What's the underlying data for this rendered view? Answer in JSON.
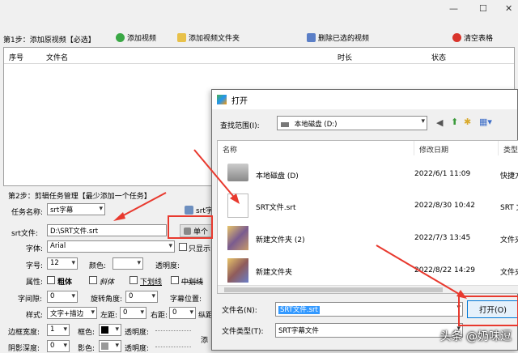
{
  "window": {
    "minimize": "—",
    "maximize": "☐",
    "close": "✕"
  },
  "step1": {
    "label": "第1步：添加原视频【必选】",
    "add_video": "添加视频",
    "add_folder": "添加视频文件夹",
    "delete_selected": "删除已选的视频",
    "clear_table": "清空表格"
  },
  "table": {
    "col_index": "序号",
    "col_filename": "文件名",
    "col_duration": "时长",
    "col_status": "状态"
  },
  "step2": {
    "label": "第2步：剪辑任务管理【最少添加一个任务】",
    "task_name_label": "任务名称:",
    "task_name_value": "srt字幕",
    "srt_file_label": "srt文件:",
    "srt_file_value": "D:\\SRT文件.srt",
    "single_button": "单个",
    "srt_button": "srt字",
    "font_label": "字体:",
    "font_value": "Arial",
    "only_show_label": "只显示",
    "size_label": "字号:",
    "size_value": "12",
    "color_label": "颜色:",
    "transparency_label": "透明度:",
    "attr_label": "属性:",
    "bold_label": "粗体",
    "italic_label": "斜体",
    "underline_label": "下划线",
    "strike_label": "中划线",
    "spacing_label": "字间隙:",
    "spacing_value": "0",
    "rotate_label": "旋转角度:",
    "rotate_value": "0",
    "position_label": "字幕位置:",
    "style_label": "样式:",
    "style_value": "文字+描边",
    "left_margin_label": "左距:",
    "left_margin_value": "0",
    "right_margin_label": "右距:",
    "right_margin_value": "0",
    "vert_label": "纵距",
    "border_width_label": "边框宽度:",
    "border_width_value": "1",
    "border_color_label": "框色:",
    "border_trans_label": "透明度:",
    "shadow_label": "阴影深度:",
    "shadow_value": "0",
    "shadow_color_label": "影色:",
    "shadow_trans_label": "透明度:",
    "add_label": "添"
  },
  "dialog": {
    "title": "打开",
    "lookin_label": "查找范围(I):",
    "lookin_value": "本地磁盘 (D:)",
    "col_name": "名称",
    "col_modified": "修改日期",
    "col_type": "类型",
    "files": [
      {
        "name": "本地磁盘 (D)",
        "date": "2022/6/1 11:09",
        "type": "快捷方"
      },
      {
        "name": "SRT文件.srt",
        "date": "2022/8/30 10:42",
        "type": "SRT 文"
      },
      {
        "name": "新建文件夹 (2)",
        "date": "2022/7/3 13:45",
        "type": "文件夹"
      },
      {
        "name": "新建文件夹",
        "date": "2022/8/22 14:29",
        "type": "文件夹"
      }
    ],
    "filename_label": "文件名(N):",
    "filename_value": "SRT文件.srt",
    "filetype_label": "文件类型(T):",
    "filetype_value": "SRT字幕文件",
    "open_button": "打开(O)"
  },
  "watermark": "头条 @奶味逗",
  "colors": {
    "accent": "#0078d7",
    "arrow": "#e8392e",
    "selection": "#3399ff"
  }
}
